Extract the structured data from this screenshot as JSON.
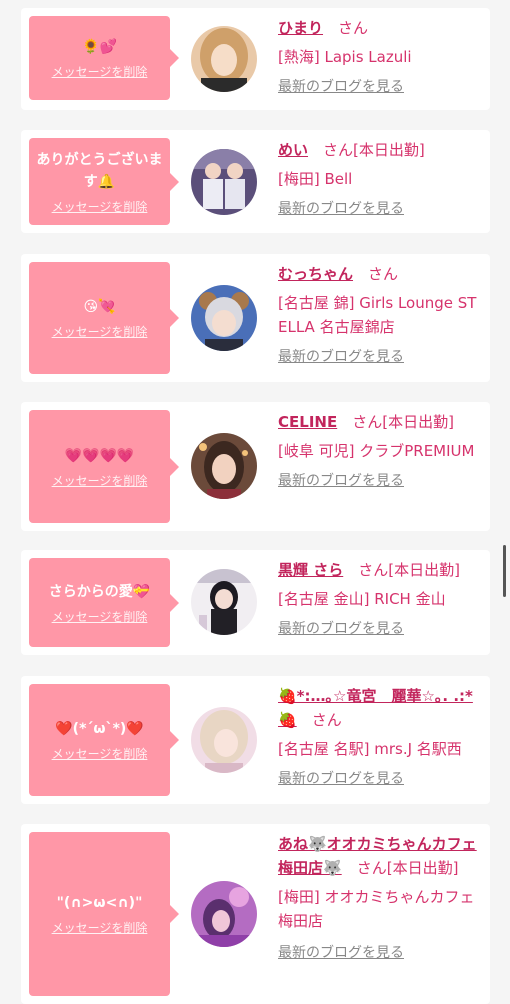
{
  "delete_label": "メッセージを削除",
  "blog_label": "最新のブログを見る",
  "honorific": "さん",
  "colors": {
    "bubble": "#ff97a7",
    "text_pink": "#d6336c",
    "link_gray": "#888888"
  },
  "cards": [
    {
      "message": "🌻💕",
      "name": "ひまり",
      "status": "",
      "location": "[熱海] Lapis Lazuli"
    },
    {
      "message": "ありがとうございます🔔",
      "name": "めい",
      "status": "[本日出勤]",
      "location": "[梅田] Bell"
    },
    {
      "message": "😘💘",
      "name": "むっちゃん",
      "status": "",
      "location": "[名古屋 錦] Girls Lounge STELLA 名古屋錦店"
    },
    {
      "message": "💗💗💗💗",
      "name": "CELINE",
      "status": "[本日出勤]",
      "location": "[岐阜 可児] クラブPREMIUM"
    },
    {
      "message": "さらからの愛💝",
      "name": "黒輝 さら",
      "status": "[本日出勤]",
      "location": "[名古屋 金山] RICH 金山"
    },
    {
      "message": "❤️(*´ω`*)❤️",
      "name": "🍓*:…｡☆竜宮　麗華☆｡. .:*🍓",
      "status": "",
      "location": "[名古屋 名駅] mrs.J 名駅西"
    },
    {
      "message": "\"(∩>ω<∩)\"",
      "name": "あね🐺オオカミちゃんカフェ梅田店🐺",
      "status": "[本日出勤]",
      "location": "[梅田] オオカミちゃんカフェ梅田店"
    }
  ]
}
